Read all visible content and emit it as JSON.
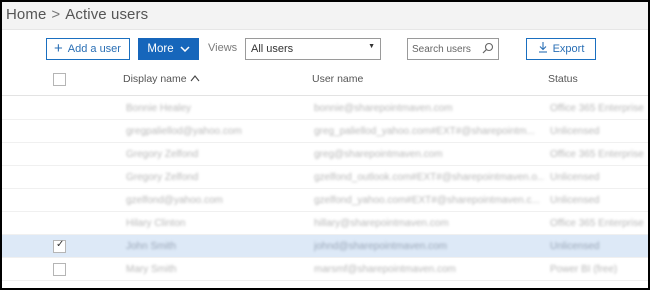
{
  "breadcrumb": {
    "home": "Home",
    "separator": ">",
    "current": "Active users"
  },
  "toolbar": {
    "add_user_label": "Add a user",
    "more_label": "More",
    "views_label": "Views",
    "views_selected": "All users",
    "search_placeholder": "Search users",
    "export_label": "Export"
  },
  "table": {
    "headers": {
      "display_name": "Display name",
      "user_name": "User name",
      "status": "Status"
    },
    "rows": [
      {
        "name": "Bonnie Healey",
        "user": "bonnie@sharepointmaven.com",
        "status": "Office 365 Enterprise"
      },
      {
        "name": "gregpaliellod@yahoo.com",
        "user": "greg_paliellod_yahoo.com#EXT#@sharepointm...",
        "status": "Unlicensed"
      },
      {
        "name": "Gregory Zelfond",
        "user": "greg@sharepointmaven.com",
        "status": "Office 365 Enterprise"
      },
      {
        "name": "Gregory Zelfond",
        "user": "gzelfond_outlook.com#EXT#@sharepointmaven.o...",
        "status": "Unlicensed"
      },
      {
        "name": "gzelfond@yahoo.com",
        "user": "gzelfond_yahoo.com#EXT#@sharepointmaven.c...",
        "status": "Unlicensed"
      },
      {
        "name": "Hilary Clinton",
        "user": "hillary@sharepointmaven.com",
        "status": "Office 365 Enterprise"
      },
      {
        "name": "John Smith",
        "user": "johnd@sharepointmaven.com",
        "status": "Unlicensed",
        "selected": true
      },
      {
        "name": "Mary Smith",
        "user": "marsmf@sharepointmaven.com",
        "status": "Power BI (free)"
      }
    ]
  },
  "colors": {
    "accent": "#1666bb",
    "selected_row": "#dde9f7",
    "breadcrumb_bg": "#f3f3f3"
  },
  "icons": [
    "plus-icon",
    "chevron-down-icon",
    "search-icon",
    "download-icon",
    "sort-up-icon",
    "checkmark-icon"
  ]
}
